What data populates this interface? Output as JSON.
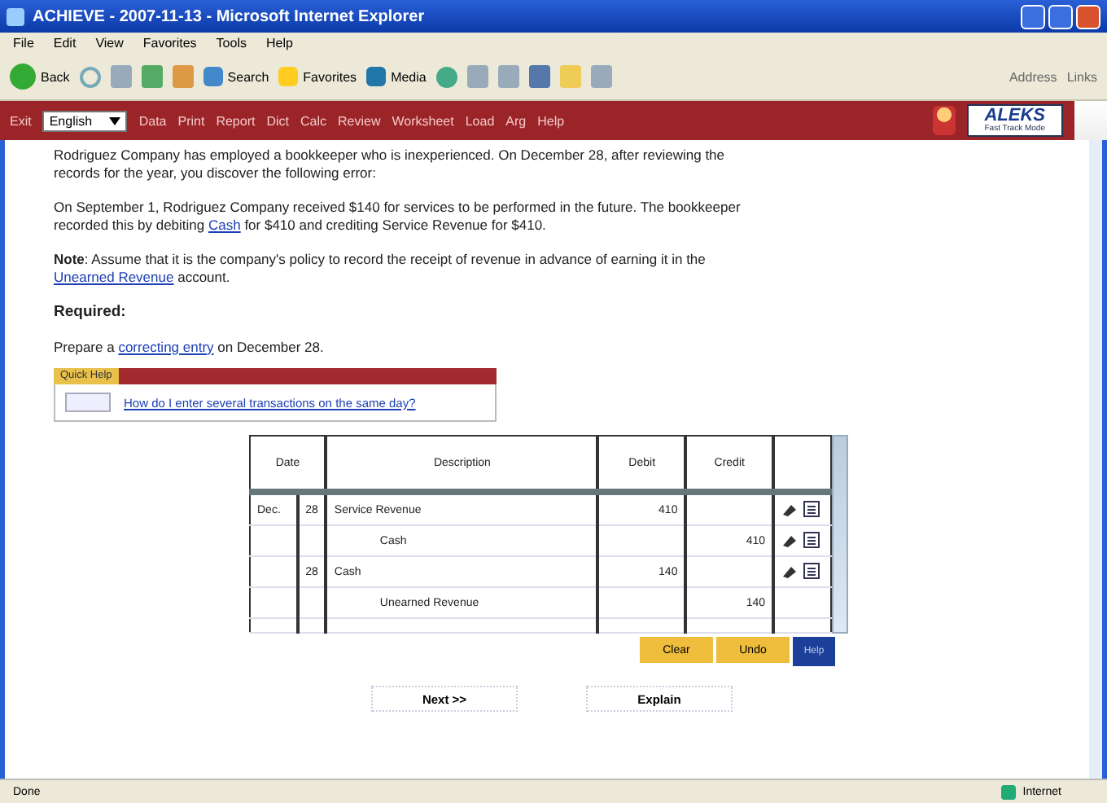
{
  "window": {
    "title": "ACHIEVE - 2007-11-13 - Microsoft Internet Explorer"
  },
  "menu": [
    "File",
    "Edit",
    "View",
    "Favorites",
    "Tools",
    "Help"
  ],
  "toolbar": {
    "back": "Back",
    "search": "Search",
    "favorites": "Favorites",
    "media": "Media",
    "address": "Address",
    "links": "Links"
  },
  "app_bar": {
    "exit": "Exit",
    "language": "English",
    "links": [
      "Data",
      "Print",
      "Report",
      "Dict",
      "Calc",
      "Review",
      "Worksheet",
      "Load",
      "Arg",
      "Help"
    ],
    "logo": "ALEKS",
    "logo_sub": "Fast Track Mode"
  },
  "problem": {
    "intro": "Rodriguez Company has employed a bookkeeper who is inexperienced. On December 28, after reviewing the records for the year, you discover the following error:",
    "error_before": "On September 1, Rodriguez Company received $140 for services to be performed in the future. The bookkeeper recorded this by debiting ",
    "error_link": "Cash",
    "error_after": " for $410 and crediting Service Revenue for $410.",
    "note_label": "Note",
    "note_before": ": Assume that it is the company's policy to record the receipt of revenue in advance of earning it in the ",
    "note_link": "Unearned Revenue",
    "note_after": " account.",
    "required": "Required:",
    "task_before": "Prepare a ",
    "task_link": "correcting entry",
    "task_after": " on December 28."
  },
  "quick_help": {
    "title": "Quick Help",
    "link": "How do I enter several transactions on the same day?"
  },
  "journal": {
    "columns": [
      "Date",
      "Description",
      "Debit",
      "Credit"
    ],
    "rows": [
      {
        "month": "Dec.",
        "day": "28",
        "description": "Service Revenue",
        "indent": false,
        "debit": "410",
        "credit": "",
        "tools": true
      },
      {
        "month": "",
        "day": "",
        "description": "Cash",
        "indent": true,
        "debit": "",
        "credit": "410",
        "tools": true
      },
      {
        "month": "",
        "day": "28",
        "description": "Cash",
        "indent": false,
        "debit": "140",
        "credit": "",
        "tools": true
      },
      {
        "month": "",
        "day": "",
        "description": "Unearned Revenue",
        "indent": true,
        "debit": "",
        "credit": "140",
        "tools": false
      }
    ]
  },
  "table_buttons": [
    "Clear",
    "Undo",
    "Help"
  ],
  "buttons": [
    "Next >>",
    "Explain"
  ],
  "status_bar": {
    "left": "Done",
    "right": "Internet"
  }
}
